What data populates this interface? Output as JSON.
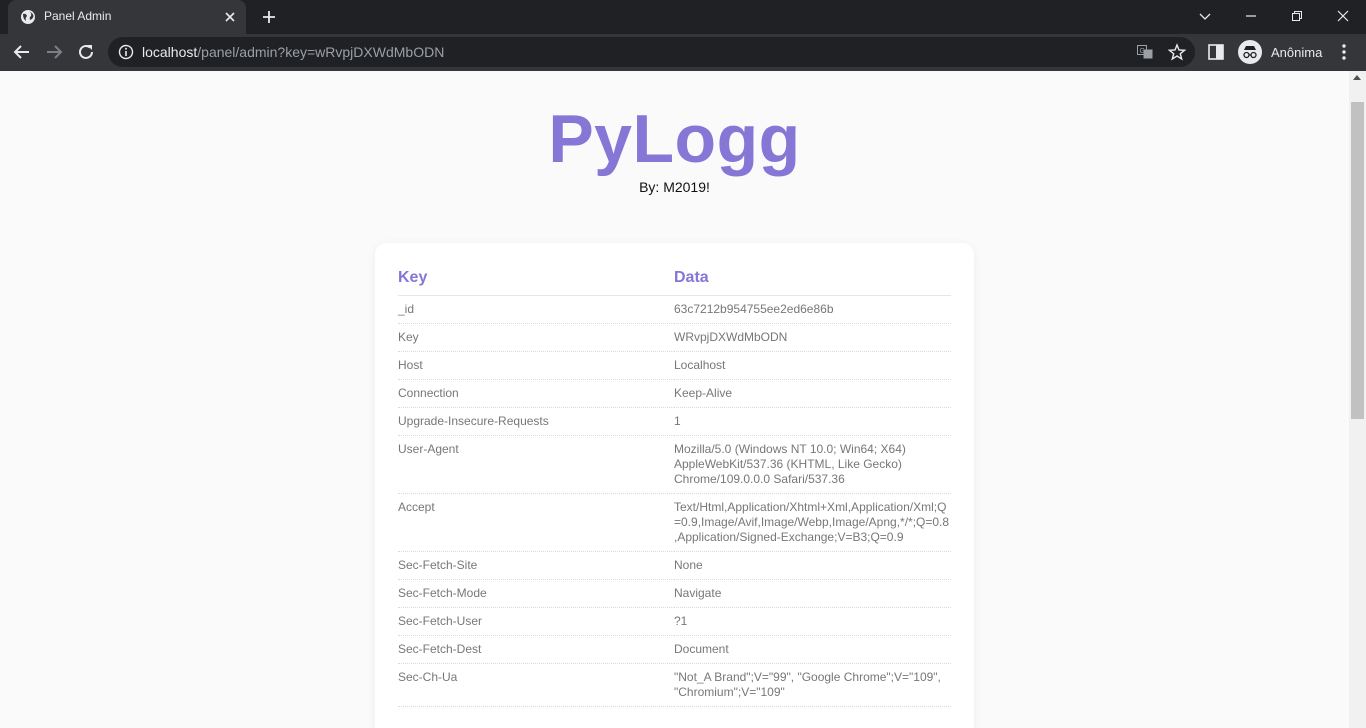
{
  "browser": {
    "tab_title": "Panel Admin",
    "url_host": "localhost",
    "url_path": "/panel/admin?key=wRvpjDXWdMbODN",
    "profile_label": "Anônima"
  },
  "page": {
    "brand": "PyLogg",
    "byline": "By: M2019!",
    "table": {
      "headers": {
        "key": "Key",
        "data": "Data"
      },
      "rows": [
        {
          "key": "_id",
          "value": "63c7212b954755ee2ed6e86b"
        },
        {
          "key": "Key",
          "value": "WRvpjDXWdMbODN"
        },
        {
          "key": "Host",
          "value": "Localhost"
        },
        {
          "key": "Connection",
          "value": "Keep-Alive"
        },
        {
          "key": "Upgrade-Insecure-Requests",
          "value": "1"
        },
        {
          "key": "User-Agent",
          "value": "Mozilla/5.0 (Windows NT 10.0; Win64; X64) AppleWebKit/537.36 (KHTML, Like Gecko) Chrome/109.0.0.0 Safari/537.36"
        },
        {
          "key": "Accept",
          "value": "Text/Html,Application/Xhtml+Xml,Application/Xml;Q=0.9,Image/Avif,Image/Webp,Image/Apng,*/*;Q=0.8,Application/Signed-Exchange;V=B3;Q=0.9"
        },
        {
          "key": "Sec-Fetch-Site",
          "value": "None"
        },
        {
          "key": "Sec-Fetch-Mode",
          "value": "Navigate"
        },
        {
          "key": "Sec-Fetch-User",
          "value": "?1"
        },
        {
          "key": "Sec-Fetch-Dest",
          "value": "Document"
        },
        {
          "key": "Sec-Ch-Ua",
          "value": "\"Not_A Brand\";V=\"99\", \"Google Chrome\";V=\"109\", \"Chromium\";V=\"109\""
        }
      ]
    }
  },
  "colors": {
    "accent": "#8676d6",
    "chrome_dark": "#202124",
    "chrome_toolbar": "#35363a"
  }
}
